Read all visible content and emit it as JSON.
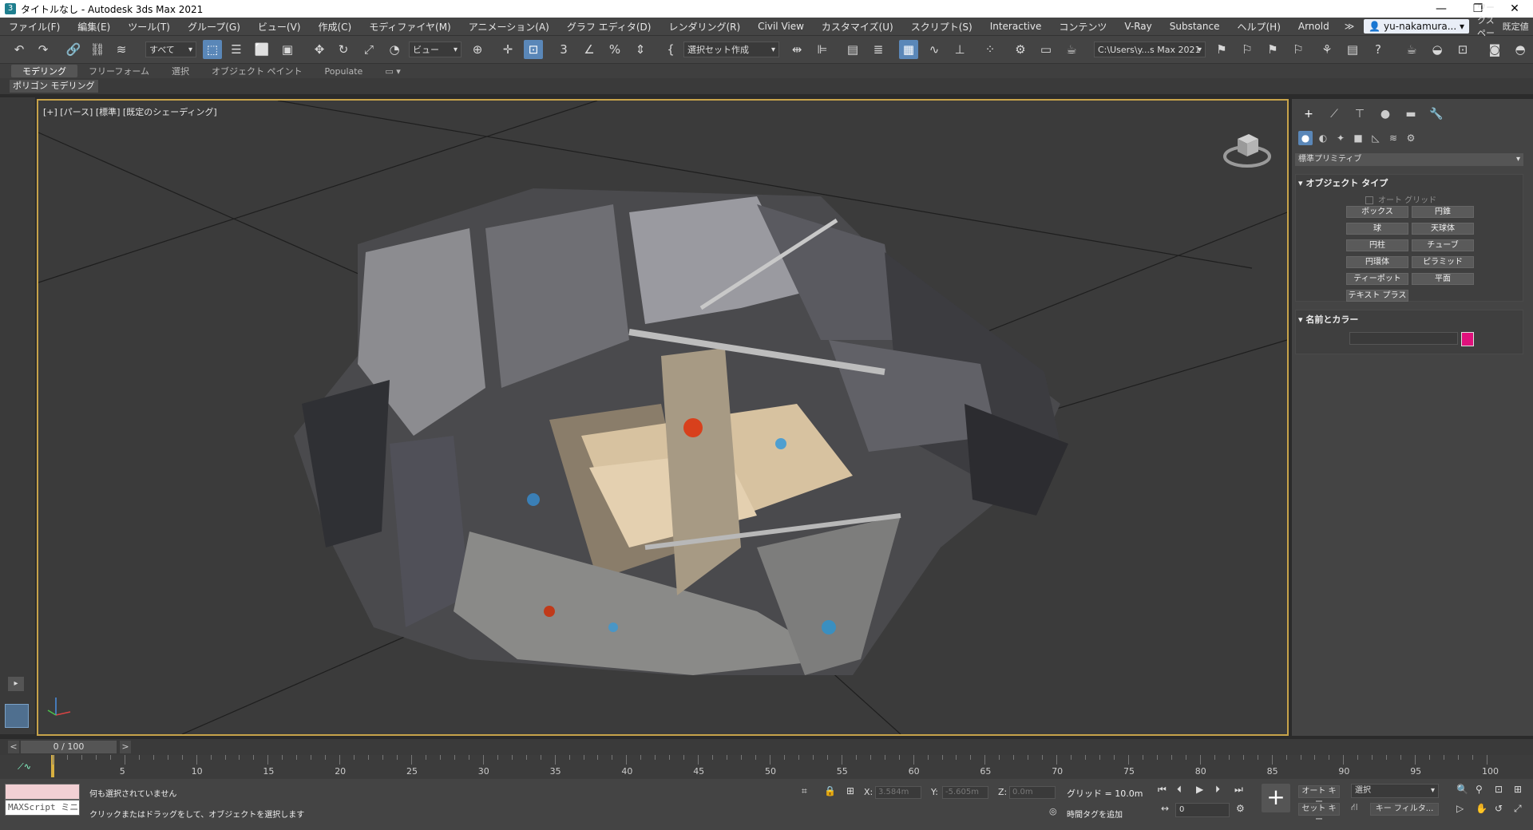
{
  "window": {
    "title": "タイトルなし - Autodesk 3ds Max 2021",
    "app_icon": "3"
  },
  "menu": {
    "items": [
      "ファイル(F)",
      "編集(E)",
      "ツール(T)",
      "グループ(G)",
      "ビュー(V)",
      "作成(C)",
      "モディファイヤ(M)",
      "アニメーション(A)",
      "グラフ エディタ(D)",
      "レンダリング(R)",
      "Civil View",
      "カスタマイズ(U)",
      "スクリプト(S)",
      "Interactive",
      "コンテンツ",
      "V-Ray",
      "Substance",
      "ヘルプ(H)",
      "Arnold"
    ],
    "more": "≫",
    "user": "yu-nakamura...",
    "workspace_label": "ワークスペース:",
    "workspace_value": "既定値"
  },
  "toolbar": {
    "selection_filter": "すべて",
    "ref_coord": "ビュー",
    "named_selection": "選択セット作成",
    "project_path": "C:\\Users\\y...s Max 2021"
  },
  "ribbon": {
    "tabs": [
      "モデリング",
      "フリーフォーム",
      "選択",
      "オブジェクト ペイント",
      "Populate"
    ],
    "panel_label": "ポリゴン モデリング"
  },
  "viewport": {
    "label": "[+] [パース] [標準] [既定のシェーディング]"
  },
  "command_panel": {
    "category": "標準プリミティブ",
    "object_type_title": "オブジェクト タイプ",
    "auto_grid": "オート グリッド",
    "buttons": [
      "ボックス",
      "円錐",
      "球",
      "天球体",
      "円柱",
      "チューブ",
      "円環体",
      "ピラミッド",
      "ティーポット",
      "平面",
      "テキスト プラス"
    ],
    "name_color_title": "名前とカラー",
    "object_color": "#e0117c"
  },
  "timeline": {
    "frame": "0 / 100",
    "prev": "<",
    "next": ">",
    "ticks": [
      "5",
      "10",
      "15",
      "20",
      "25",
      "30",
      "35",
      "40",
      "45",
      "50",
      "55",
      "60",
      "65",
      "70",
      "75",
      "80",
      "85",
      "90",
      "95",
      "100"
    ]
  },
  "status": {
    "maxscript": "MAXScript ミニ",
    "selection": "何も選択されていません",
    "prompt": "クリックまたはドラッグをして、オブジェクトを選択します",
    "x_label": "X:",
    "x_value": "3.584m",
    "y_label": "Y:",
    "y_value": "-5.605m",
    "z_label": "Z:",
    "z_value": "0.0m",
    "grid": "グリッド = 10.0m",
    "add_time_tag": "時間タグを追加",
    "auto_key": "オート キー",
    "set_key": "セット キー",
    "key_mode": "選択",
    "key_filters": "キー フィルタ...",
    "frame_field": "0"
  }
}
